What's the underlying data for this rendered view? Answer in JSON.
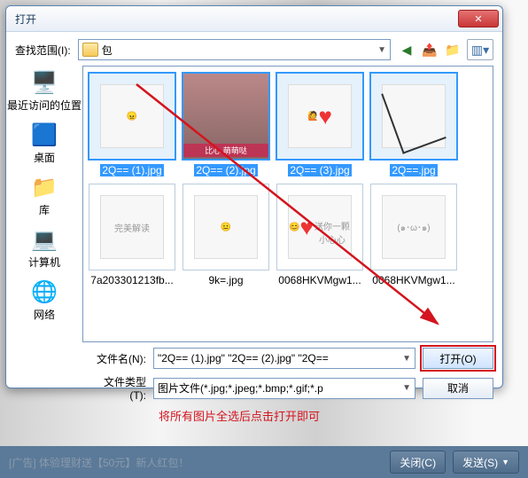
{
  "dialog": {
    "title": "打开",
    "look_in_label": "查找范围(I):",
    "folder_name": "包",
    "places": [
      {
        "label": "最近访问的位置",
        "icon": "🖥️"
      },
      {
        "label": "桌面",
        "icon": "🟦"
      },
      {
        "label": "库",
        "icon": "📁"
      },
      {
        "label": "计算机",
        "icon": "💻"
      },
      {
        "label": "网络",
        "icon": "🌐"
      }
    ],
    "files": [
      {
        "name": "2Q== (1).jpg",
        "selected": true,
        "kind": "sketch-face"
      },
      {
        "name": "2Q== (2).jpg",
        "selected": true,
        "kind": "photo"
      },
      {
        "name": "2Q== (3).jpg",
        "selected": true,
        "kind": "hand-heart"
      },
      {
        "name": "2Q==.jpg",
        "selected": true,
        "kind": "finger"
      },
      {
        "name": "7a203301213fb...",
        "selected": false,
        "kind": "text-img",
        "text": "完美解读"
      },
      {
        "name": "9k=.jpg",
        "selected": false,
        "kind": "bald-face"
      },
      {
        "name": "0068HKVMgw1...",
        "selected": false,
        "kind": "round-heart",
        "text": "送你一颗小心心"
      },
      {
        "name": "0068HKVMgw1...",
        "selected": false,
        "kind": "round-blush"
      }
    ],
    "filename_label": "文件名(N):",
    "filename_value": "\"2Q== (1).jpg\" \"2Q== (2).jpg\" \"2Q==",
    "filetype_label": "文件类型(T):",
    "filetype_value": "图片文件(*.jpg;*.jpeg;*.bmp;*.gif;*.p",
    "open_btn": "打开(O)",
    "cancel_btn": "取消",
    "annotation": "将所有图片全选后点击打开即可"
  },
  "footer": {
    "ad": "[广告] 体验理财送【50元】新人红包！",
    "close": "关闭(C)",
    "send": "发送(S)"
  }
}
